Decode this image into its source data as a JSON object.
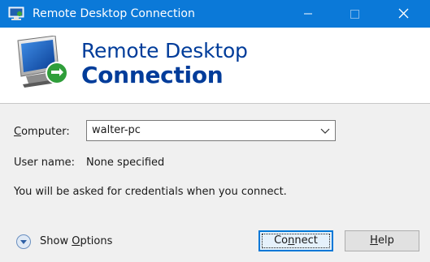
{
  "window": {
    "title": "Remote Desktop Connection",
    "controls": {
      "minimize": "minimize-icon",
      "maximize": "maximize-icon",
      "close": "close-icon"
    }
  },
  "banner": {
    "line1": "Remote Desktop",
    "line2": "Connection",
    "icon": "remote-desktop-icon"
  },
  "form": {
    "computer_label_first": "C",
    "computer_label_rest": "omputer:",
    "computer_value": "walter-pc",
    "username_label": "User name:",
    "username_value": "None specified",
    "credentials_message": "You will be asked for credentials when you connect."
  },
  "footer": {
    "show_options_prefix": "Show ",
    "show_options_underlined": "O",
    "show_options_suffix": "ptions",
    "connect_prefix": "Co",
    "connect_underlined": "n",
    "connect_suffix": "nect",
    "help_underlined": "H",
    "help_suffix": "elp"
  },
  "colors": {
    "titlebar": "#0b79d8",
    "banner_text": "#003c9a",
    "focus_border": "#0078d7"
  }
}
